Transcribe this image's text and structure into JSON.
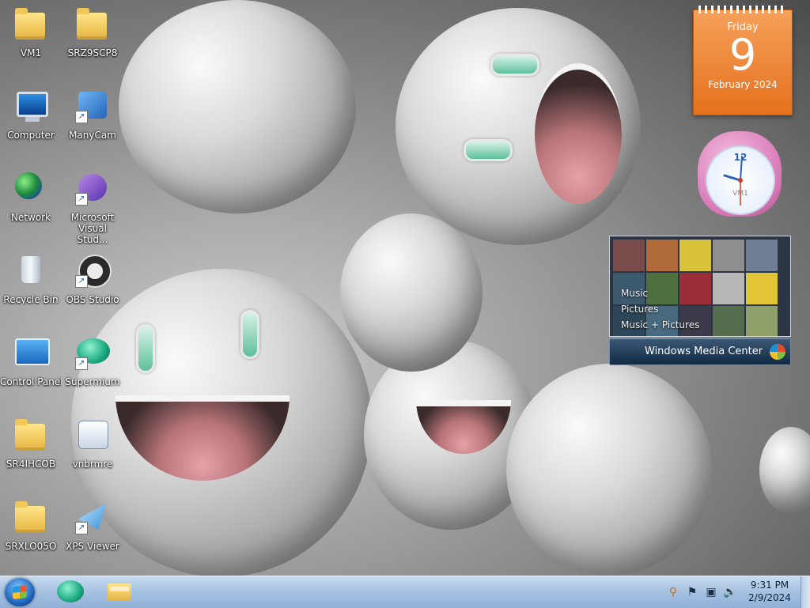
{
  "desktop": {
    "icons": [
      {
        "label": "VM1"
      },
      {
        "label": "SRZ9SCP8"
      },
      {
        "label": "Computer"
      },
      {
        "label": "ManyCam"
      },
      {
        "label": "Network"
      },
      {
        "label": "Microsoft Visual Stud..."
      },
      {
        "label": "Recycle Bin"
      },
      {
        "label": "OBS Studio"
      },
      {
        "label": "Control Panel"
      },
      {
        "label": "Supermium"
      },
      {
        "label": "SR4IHCOB"
      },
      {
        "label": "vnbrmre"
      },
      {
        "label": "SRXLO05O"
      },
      {
        "label": "XPS Viewer"
      }
    ]
  },
  "gadgets": {
    "calendar": {
      "weekday": "Friday",
      "day": "9",
      "month_year": "February 2024"
    },
    "clock": {
      "twelve": "12",
      "owner": "VM1"
    },
    "media_center": {
      "menu": [
        "Music",
        "Pictures",
        "Music + Pictures"
      ],
      "title": "Windows Media Center"
    }
  },
  "taskbar": {
    "time": "9:31 PM",
    "date": "2/9/2024"
  },
  "colors": {
    "calendar_orange": "#e5711d",
    "taskbar_blue": "#a7c3e2"
  }
}
